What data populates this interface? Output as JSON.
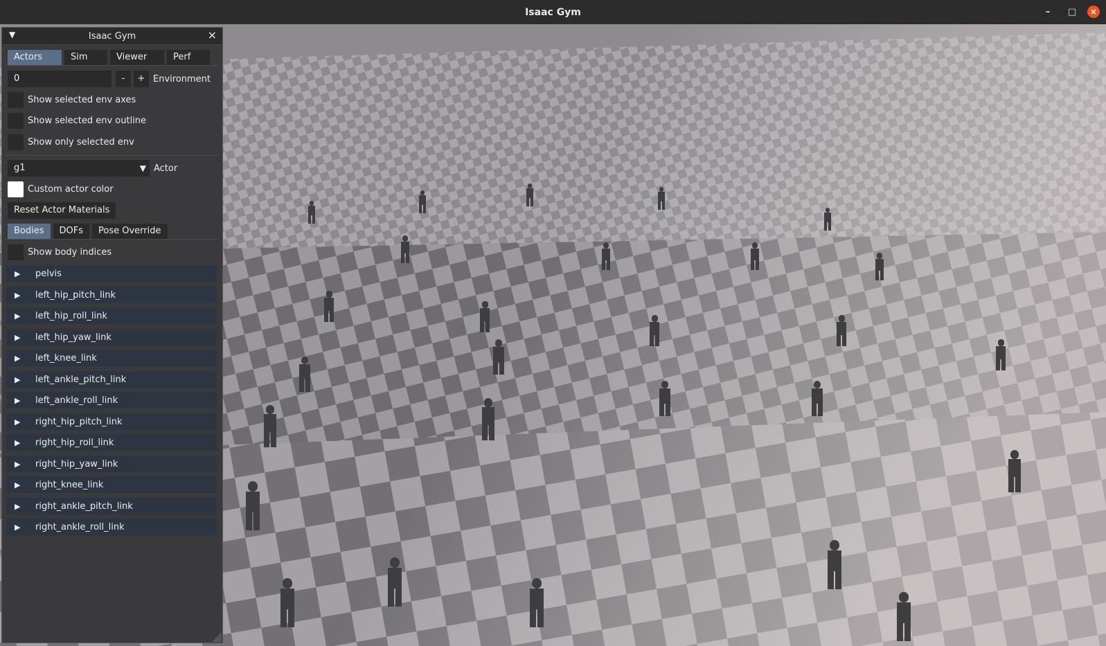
{
  "window": {
    "title": "Isaac Gym",
    "controls": {
      "minimize": "–",
      "maximize": "□",
      "close": "×"
    }
  },
  "panel": {
    "title": "Isaac Gym",
    "close_label": "×",
    "collapse_icon": "collapse-triangle",
    "tabs": [
      {
        "label": "Actors",
        "active": true
      },
      {
        "label": "Sim",
        "active": false
      },
      {
        "label": "Viewer",
        "active": false
      },
      {
        "label": "Perf",
        "active": false
      }
    ],
    "environment": {
      "value": "0",
      "minus": "-",
      "plus": "+",
      "label": "Environment"
    },
    "checkboxes": [
      {
        "label": "Show selected env axes",
        "checked": false
      },
      {
        "label": "Show selected env outline",
        "checked": false
      },
      {
        "label": "Show only selected env",
        "checked": false
      }
    ],
    "actor": {
      "value": "g1",
      "label": "Actor"
    },
    "custom_color": {
      "label": "Custom actor color",
      "color": "#ffffff"
    },
    "reset_button": "Reset Actor Materials",
    "sub_tabs": [
      {
        "label": "Bodies",
        "active": true
      },
      {
        "label": "DOFs",
        "active": false
      },
      {
        "label": "Pose Override",
        "active": false
      }
    ],
    "show_body_indices": "Show body indices",
    "bodies": [
      "pelvis",
      "left_hip_pitch_link",
      "left_hip_roll_link",
      "left_hip_yaw_link",
      "left_knee_link",
      "left_ankle_pitch_link",
      "left_ankle_roll_link",
      "right_hip_pitch_link",
      "right_hip_roll_link",
      "right_hip_yaw_link",
      "right_knee_link",
      "right_ankle_pitch_link",
      "right_ankle_roll_link"
    ]
  },
  "colors": {
    "panel_bg": "#3a3a3c",
    "active_tab": "#5a6e88",
    "tree_item_bg": "#2d3542",
    "close_button": "#e9541f",
    "floor_light": "#b9b6b8",
    "floor_dark": "#7a787b"
  }
}
